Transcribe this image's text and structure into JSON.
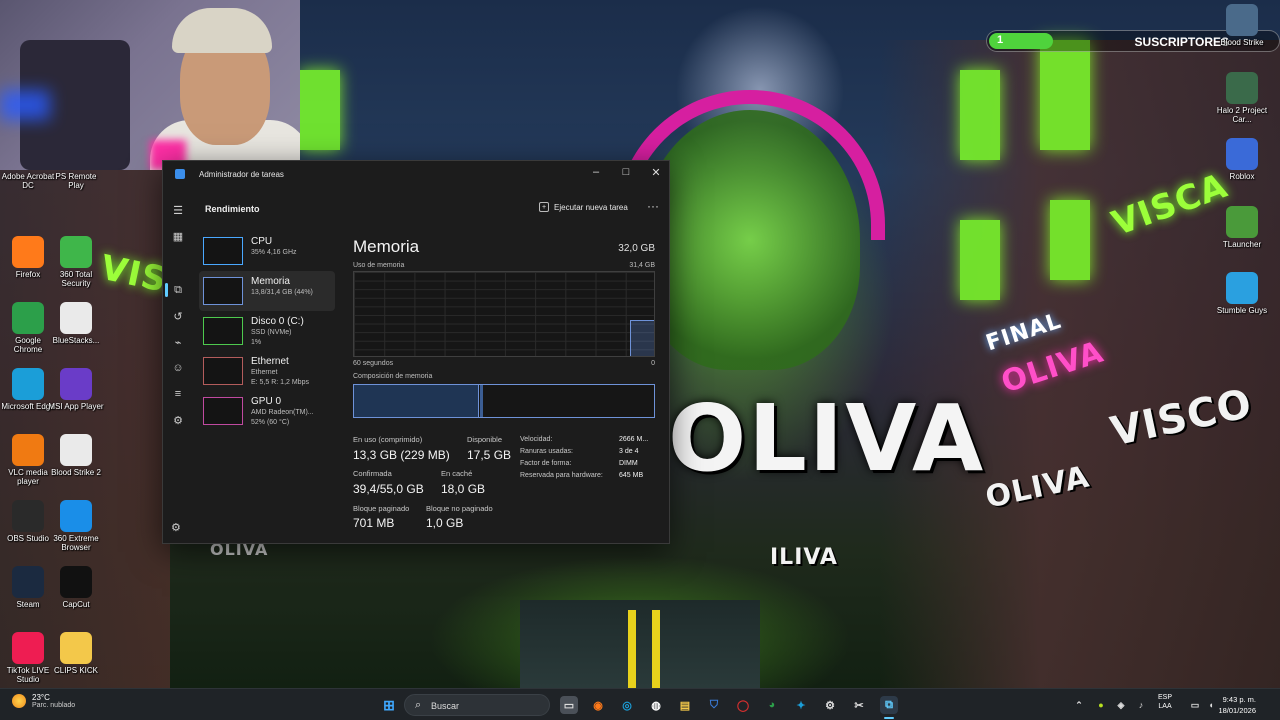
{
  "overlay": {
    "sub_count": "1",
    "sub_label": "SUSCRIPTORES",
    "sub_progress_fraction": 0.22
  },
  "wallpaper": {
    "big_name": "OLIVA",
    "neon_words": [
      "VISCA",
      "FINAL",
      "OLIVA",
      "VISCO",
      "OLIVA",
      "VISCO",
      "OLIVA",
      "ILIVA"
    ]
  },
  "desktop_left": [
    {
      "label": "Adobe Acrobat DC",
      "icon": "acrobat-icon",
      "color": "#d32f2f"
    },
    {
      "label": "PS Remote Play",
      "icon": "ps-remote-icon",
      "color": "#1f4fbf"
    },
    {
      "label": "Firefox",
      "icon": "firefox-icon",
      "color": "#ff7a1a"
    },
    {
      "label": "360 Total Security",
      "icon": "360-security-icon",
      "color": "#3fb64a"
    },
    {
      "label": "Google Chrome",
      "icon": "chrome-icon",
      "color": "#2c9f4a"
    },
    {
      "label": "BlueStacks...",
      "icon": "bluestacks-icon",
      "color": "#eaeaea"
    },
    {
      "label": "Microsoft Edge",
      "icon": "edge-icon",
      "color": "#1b9ed8"
    },
    {
      "label": "MSI App Player",
      "icon": "msi-app-player-icon",
      "color": "#6a3cc8"
    },
    {
      "label": "VLC media player",
      "icon": "vlc-icon",
      "color": "#f07a12"
    },
    {
      "label": "Blood Strike 2",
      "icon": "blood-strike-icon",
      "color": "#eaeaea"
    },
    {
      "label": "OBS Studio",
      "icon": "obs-icon",
      "color": "#2a2a2a"
    },
    {
      "label": "360 Extreme Browser",
      "icon": "360-browser-icon",
      "color": "#1a8ee8"
    },
    {
      "label": "Steam",
      "icon": "steam-icon",
      "color": "#1b2a40"
    },
    {
      "label": "CapCut",
      "icon": "capcut-icon",
      "color": "#111111"
    },
    {
      "label": "TikTok LIVE Studio",
      "icon": "tiktok-live-icon",
      "color": "#ee1d52"
    },
    {
      "label": "CLIPS KICK",
      "icon": "folder-icon",
      "color": "#f3c84a"
    }
  ],
  "desktop_right": [
    {
      "label": "Blood Strike",
      "icon": "blood-strike-game-icon",
      "color": "#4a6a8a"
    },
    {
      "label": "Halo 2 Project Car...",
      "icon": "halo2-icon",
      "color": "#3a6a4a"
    },
    {
      "label": "Roblox",
      "icon": "roblox-icon",
      "color": "#3a6ad8"
    },
    {
      "label": "TLauncher",
      "icon": "tlauncher-icon",
      "color": "#4a9a3a"
    },
    {
      "label": "Stumble Guys",
      "icon": "stumble-guys-icon",
      "color": "#2aa0e0"
    }
  ],
  "taskmgr": {
    "window_title": "Administrador de tareas",
    "page_title": "Rendimiento",
    "run_task": "Ejecutar nueva tarea",
    "more": "···",
    "processes": [
      {
        "name": "CPU",
        "sub": "35%  4,16 GHz",
        "color": "#4aa8ff",
        "selected": false
      },
      {
        "name": "Memoria",
        "sub": "13,8/31,4 GB (44%)",
        "color": "#6e92d8",
        "selected": true
      },
      {
        "name": "Disco 0 (C:)",
        "sub": "SSD (NVMe)\n1%",
        "color": "#4ec94e",
        "selected": false
      },
      {
        "name": "Ethernet",
        "sub": "Ethernet\nE: 5,5 R: 1,2 Mbps",
        "color": "#b35c5c",
        "selected": false
      },
      {
        "name": "GPU 0",
        "sub": "AMD Radeon(TM)...\n52% (60 °C)",
        "color": "#c04aa0",
        "selected": false
      }
    ],
    "memory": {
      "title": "Memoria",
      "total": "32,0 GB",
      "usage_label": "Uso de memoria",
      "usage_max": "31,4 GB",
      "time_left": "60 segundos",
      "time_right": "0",
      "composition_label": "Composición de memoria",
      "usage_fraction": 0.44,
      "stats": {
        "in_use_label": "En uso (comprimido)",
        "in_use_value": "13,3 GB (229 MB)",
        "available_label": "Disponible",
        "available_value": "17,5 GB",
        "committed_label": "Confirmada",
        "committed_value": "39,4/55,0 GB",
        "cached_label": "En caché",
        "cached_value": "18,0 GB",
        "paged_label": "Bloque paginado",
        "paged_value": "701 MB",
        "nonpaged_label": "Bloque no paginado",
        "nonpaged_value": "1,0 GB"
      },
      "details": [
        {
          "k": "Velocidad:",
          "v": "2666 M..."
        },
        {
          "k": "Ranuras usadas:",
          "v": "3 de 4"
        },
        {
          "k": "Factor de forma:",
          "v": "DIMM"
        },
        {
          "k": "Reservada para hardware:",
          "v": "645 MB"
        }
      ]
    }
  },
  "taskbar": {
    "temp": "23°C",
    "condition": "Parc. nublado",
    "search_placeholder": "Buscar",
    "lang_top": "ESP",
    "lang_bottom": "LAA",
    "time": "9:43 p. m.",
    "date": "18/01/2026"
  }
}
